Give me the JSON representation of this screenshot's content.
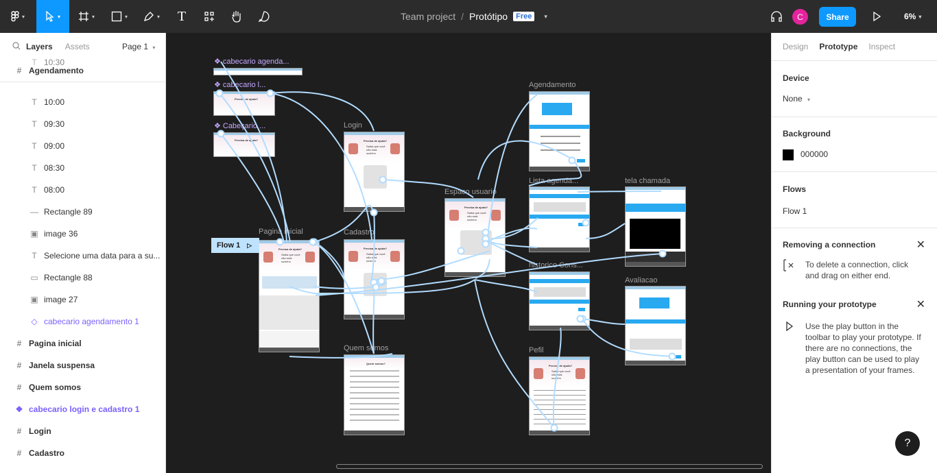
{
  "toolbar": {
    "breadcrumb_team": "Team project",
    "breadcrumb_sep": "/",
    "file_name": "Protótipo",
    "plan_badge": "Free",
    "share_label": "Share",
    "avatar_initial": "C",
    "zoom": "6%"
  },
  "left_panel": {
    "tabs": [
      "Layers",
      "Assets"
    ],
    "page_selector": "Page 1",
    "layers": [
      {
        "label": "Agendamento",
        "kind": "frame"
      },
      {
        "label": "10:30",
        "kind": "text"
      },
      {
        "label": "10:00",
        "kind": "text"
      },
      {
        "label": "09:30",
        "kind": "text"
      },
      {
        "label": "09:00",
        "kind": "text"
      },
      {
        "label": "08:30",
        "kind": "text"
      },
      {
        "label": "08:00",
        "kind": "text"
      },
      {
        "label": "Rectangle 89",
        "kind": "line"
      },
      {
        "label": "image 36",
        "kind": "image"
      },
      {
        "label": "Selecione uma data para a su...",
        "kind": "text"
      },
      {
        "label": "Rectangle 88",
        "kind": "rect"
      },
      {
        "label": "image 27",
        "kind": "image"
      },
      {
        "label": "cabecario agendamento 1",
        "kind": "instance"
      },
      {
        "label": "Pagina inicial",
        "kind": "frame"
      },
      {
        "label": "Janela suspensa",
        "kind": "frame"
      },
      {
        "label": "Quem somos",
        "kind": "frame"
      },
      {
        "label": "cabecario login e cadastro 1",
        "kind": "component"
      },
      {
        "label": "Login",
        "kind": "frame"
      },
      {
        "label": "Cadastro",
        "kind": "frame"
      }
    ]
  },
  "canvas": {
    "flow_tag": "Flow 1",
    "frames": [
      {
        "label": "cabecario agenda...",
        "kind": "component"
      },
      {
        "label": "cabecario l...",
        "kind": "component"
      },
      {
        "label": "Cabeçario ...",
        "kind": "component"
      },
      {
        "label": "Login",
        "kind": "frame"
      },
      {
        "label": "Pagina inicial",
        "kind": "frame"
      },
      {
        "label": "Cadastro",
        "kind": "frame"
      },
      {
        "label": "Quem somos",
        "kind": "frame"
      },
      {
        "label": "Espaco usuario",
        "kind": "frame"
      },
      {
        "label": "Agendamento",
        "kind": "frame"
      },
      {
        "label": "Lista agenda...",
        "kind": "frame"
      },
      {
        "label": "historico Cons...",
        "kind": "frame"
      },
      {
        "label": "Pefil",
        "kind": "frame"
      },
      {
        "label": "tela chamada",
        "kind": "frame"
      },
      {
        "label": "Avaliacao",
        "kind": "frame"
      }
    ],
    "mini_text": {
      "help": "Precisa de ajuda?",
      "sub": "Saiba que você não está sozinho",
      "quem": "Quem somos?"
    }
  },
  "right_panel": {
    "tabs": [
      "Design",
      "Prototype",
      "Inspect"
    ],
    "device_heading": "Device",
    "device_value": "None",
    "background_heading": "Background",
    "background_value": "000000",
    "flows_heading": "Flows",
    "flow_item": "Flow 1",
    "remove_heading": "Removing a connection",
    "remove_body": "To delete a connection, click and drag on either end.",
    "run_heading": "Running your prototype",
    "run_body": "Use the play button in the toolbar to play your prototype. If there are no connections, the play button can be used to play a presentation of your frames."
  },
  "colors": {
    "accent": "#0d99ff",
    "connector": "#b3dcff",
    "component": "#7b61ff"
  }
}
